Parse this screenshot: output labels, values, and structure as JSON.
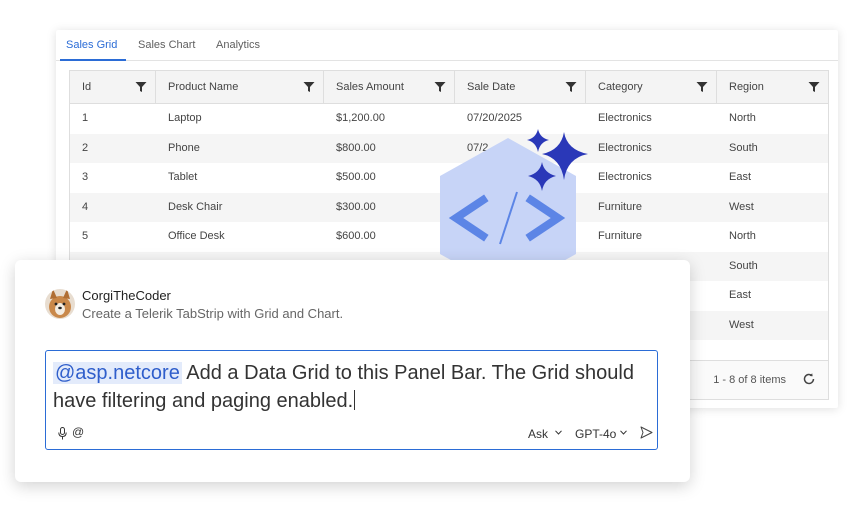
{
  "tabs": [
    {
      "label": "Sales Grid"
    },
    {
      "label": "Sales Chart"
    },
    {
      "label": "Analytics"
    }
  ],
  "grid": {
    "columns": [
      {
        "label": "Id"
      },
      {
        "label": "Product Name"
      },
      {
        "label": "Sales Amount"
      },
      {
        "label": "Sale Date"
      },
      {
        "label": "Category"
      },
      {
        "label": "Region"
      }
    ],
    "rows": [
      [
        "1",
        "Laptop",
        "$1,200.00",
        "07/20/2025",
        "Electronics",
        "North"
      ],
      [
        "2",
        "Phone",
        "$800.00",
        "07/2",
        "Electronics",
        "South"
      ],
      [
        "3",
        "Tablet",
        "$500.00",
        "",
        "Electronics",
        "East"
      ],
      [
        "4",
        "Desk Chair",
        "$300.00",
        "",
        "Furniture",
        "West"
      ],
      [
        "5",
        "Office Desk",
        "$600.00",
        "",
        "Furniture",
        "North"
      ],
      [
        "",
        "",
        "",
        "",
        "",
        "South"
      ],
      [
        "",
        "",
        "",
        "",
        "",
        "East"
      ],
      [
        "",
        "",
        "",
        "",
        "",
        "West"
      ]
    ],
    "pager_info": "1 - 8 of 8 items"
  },
  "chat": {
    "username": "CorgiTheCoder",
    "subtitle": "Create a Telerik TabStrip with Grid and Chart.",
    "prompt_mention": "@asp.netcore",
    "prompt_text": " Add a Data Grid to this Panel Bar. The Grid should have filtering and paging enabled.",
    "at_symbol": "@",
    "mode": "Ask",
    "model": "GPT-4o"
  },
  "colors": {
    "accent": "#2b6cd6",
    "hex_fill": "#c7d4f7",
    "hex_code": "#5c85e6",
    "sparkle": "#2a38b8"
  }
}
